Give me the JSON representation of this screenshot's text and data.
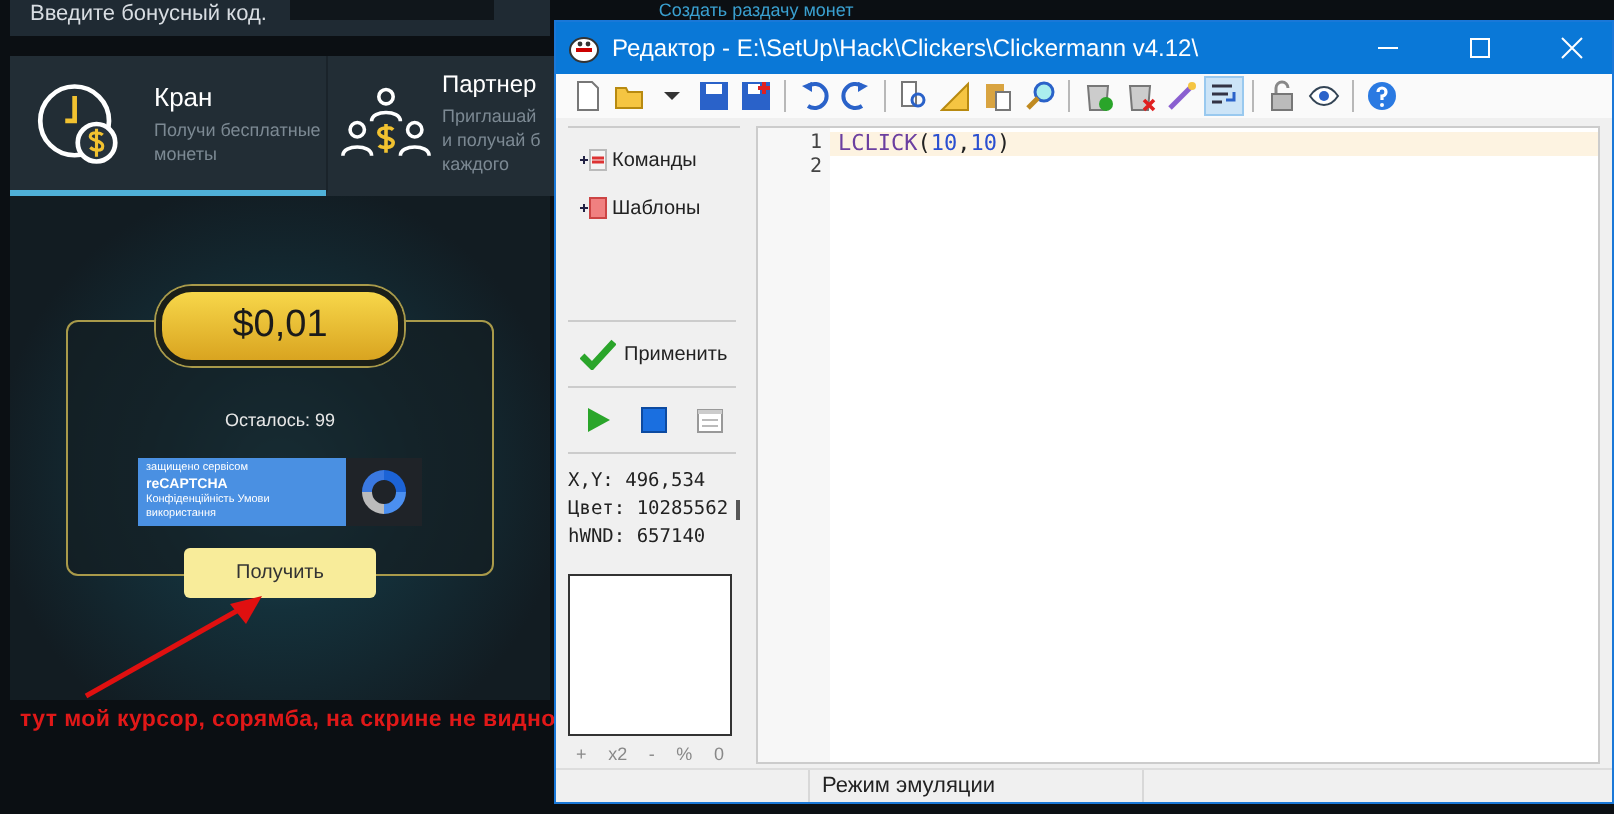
{
  "page": {
    "bonus_label": "Введите бонусный код.",
    "create_link": "Создать раздачу монет",
    "tabs": [
      {
        "kind": "faucet",
        "title": "Кран",
        "desc": [
          "Получи бесплатные",
          "монеты"
        ],
        "selected": true
      },
      {
        "kind": "partner",
        "title": "Партнер",
        "desc": [
          "Приглашай",
          "и получай б",
          "каждого"
        ],
        "selected": false
      }
    ],
    "faucet": {
      "amount": "$0,01",
      "remaining": "Осталось: 99",
      "captcha": [
        "защищено сервісом",
        "reCAPTCHA",
        "Конфіденційність  Умови використання"
      ],
      "button": "Получить"
    },
    "annotation": "тут мой курсор, сорямба, на скрине не видно"
  },
  "window": {
    "title": "Редактор - E:\\SetUp\\Hack\\Clickers\\Clickermann v4.12\\",
    "toolbar": [
      {
        "kind": "new",
        "on": false
      },
      {
        "kind": "open",
        "on": false
      },
      {
        "kind": "dropdown",
        "on": false
      },
      {
        "kind": "save",
        "on": false
      },
      {
        "kind": "save-as",
        "on": false
      },
      {
        "kind": "separator"
      },
      {
        "kind": "undo",
        "on": false
      },
      {
        "kind": "redo",
        "on": false
      },
      {
        "kind": "separator"
      },
      {
        "kind": "preview",
        "on": false
      },
      {
        "kind": "ruler",
        "on": false
      },
      {
        "kind": "paste",
        "on": false
      },
      {
        "kind": "search",
        "on": false
      },
      {
        "kind": "separator"
      },
      {
        "kind": "trash-ok",
        "on": false
      },
      {
        "kind": "trash-x",
        "on": false
      },
      {
        "kind": "wand",
        "on": false
      },
      {
        "kind": "wrap",
        "on": true
      },
      {
        "kind": "separator"
      },
      {
        "kind": "lock",
        "on": false
      },
      {
        "kind": "eye",
        "on": false
      },
      {
        "kind": "separator"
      },
      {
        "kind": "help",
        "on": false
      }
    ],
    "side_items": [
      {
        "kind": "commands",
        "label": "Команды"
      },
      {
        "kind": "templates",
        "label": "Шаблоны"
      }
    ],
    "apply": "Применить",
    "info": [
      {
        "label": "X,Y:",
        "value": "496,534",
        "swatch": false
      },
      {
        "label": "Цвет:",
        "value": "10285562",
        "swatch": true
      },
      {
        "label": "hWND:",
        "value": "657140",
        "swatch": false
      }
    ],
    "zoom_controls": [
      "+",
      "x2",
      "-",
      "%",
      "0"
    ],
    "lines": [
      {
        "number": "1",
        "current": true,
        "tokens": [
          {
            "kind": "keyword",
            "text": "LCLICK"
          },
          {
            "kind": "punct",
            "text": "("
          },
          {
            "kind": "number",
            "text": "10"
          },
          {
            "kind": "punct",
            "text": ","
          },
          {
            "kind": "number",
            "text": "10"
          },
          {
            "kind": "punct",
            "text": ")"
          }
        ]
      },
      {
        "number": "2",
        "current": false
      }
    ],
    "status": "Режим эмуляции"
  }
}
